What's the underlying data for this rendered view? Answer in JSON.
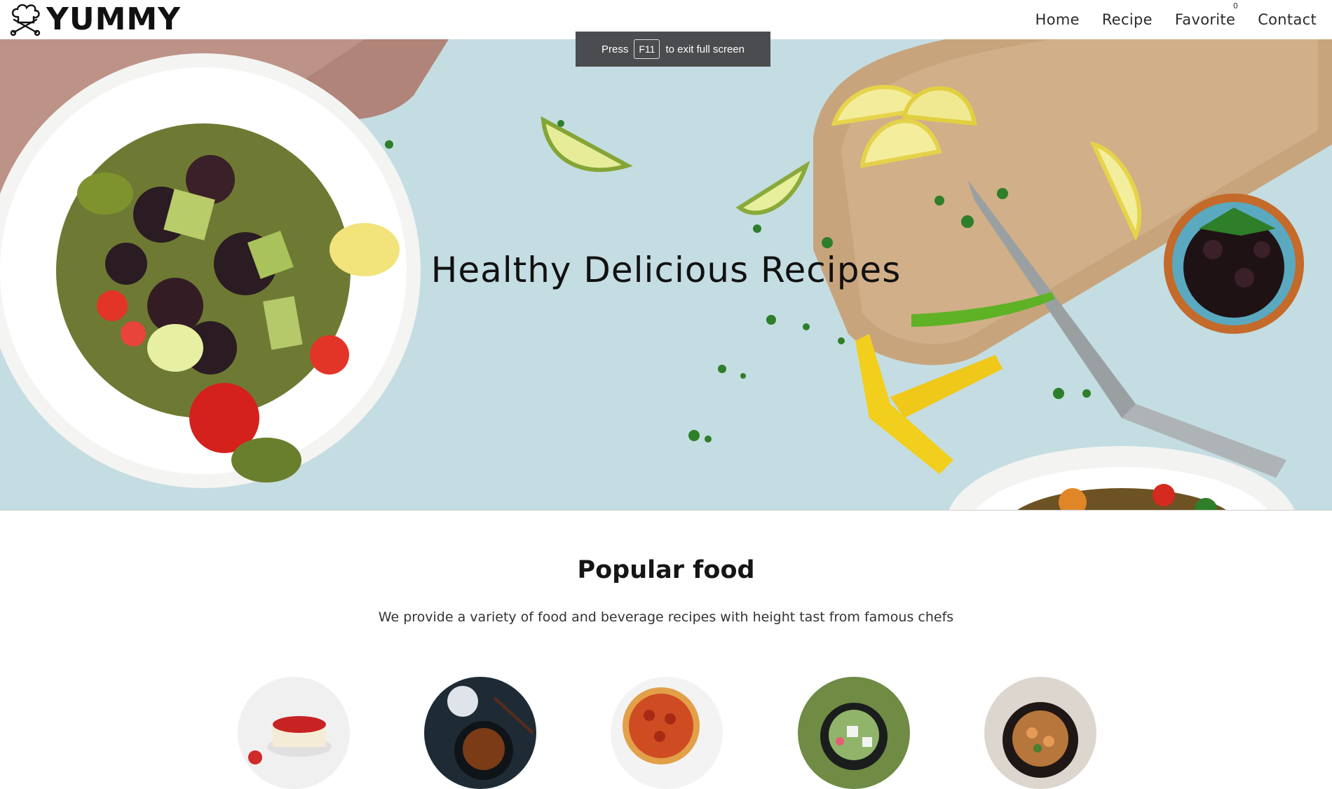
{
  "brand": {
    "name": "YUMMY",
    "icon": "chef-hat-icon"
  },
  "nav": {
    "items": [
      {
        "label": "Home"
      },
      {
        "label": "Recipe"
      },
      {
        "label": "Favorite",
        "count": "0"
      },
      {
        "label": "Contact"
      }
    ]
  },
  "fullscreen_notice": {
    "prefix": "Press",
    "key": "F11",
    "suffix": "to exit full screen"
  },
  "hero": {
    "title": "Healthy Delicious Recipes"
  },
  "popular": {
    "title": "Popular food",
    "subtitle": "We provide a variety of food and beverage recipes with height tast from famous chefs",
    "items": [
      {
        "name": "strawberry-cheesecake",
        "icon": "cake-image"
      },
      {
        "name": "glazed-chicken-bowl",
        "icon": "bowl-image"
      },
      {
        "name": "pepperoni-pizza",
        "icon": "pizza-image"
      },
      {
        "name": "green-salad",
        "icon": "salad-image"
      },
      {
        "name": "shrimp-skillet",
        "icon": "skillet-image"
      }
    ]
  },
  "colors": {
    "hero_background": "#c5dfe3",
    "toast_background": "#4a4c4f",
    "text": "#111111"
  }
}
